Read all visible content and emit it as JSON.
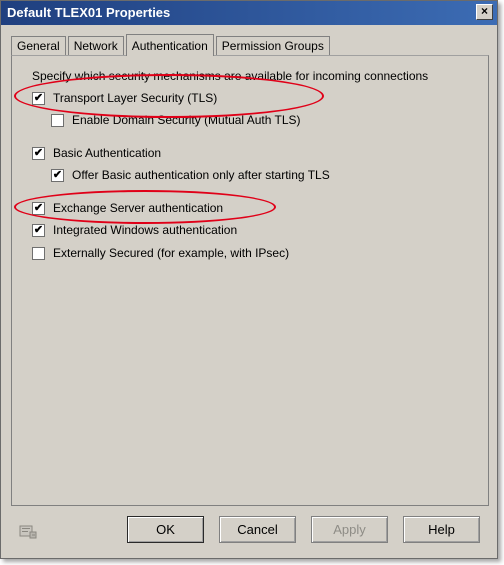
{
  "window": {
    "title": "Default TLEX01 Properties",
    "close_glyph": "×"
  },
  "tabs": [
    {
      "label": "General",
      "active": false
    },
    {
      "label": "Network",
      "active": false
    },
    {
      "label": "Authentication",
      "active": true
    },
    {
      "label": "Permission Groups",
      "active": false
    }
  ],
  "panel": {
    "description": "Specify which security mechanisms are available for incoming connections",
    "options": [
      {
        "label": "Transport Layer Security (TLS)",
        "checked": true,
        "indent": 0
      },
      {
        "label": "Enable Domain Security (Mutual Auth TLS)",
        "checked": false,
        "indent": 1
      },
      {
        "label": "Basic Authentication",
        "checked": true,
        "indent": 0
      },
      {
        "label": "Offer Basic authentication only after starting TLS",
        "checked": true,
        "indent": 1
      },
      {
        "label": "Exchange Server authentication",
        "checked": true,
        "indent": 0
      },
      {
        "label": "Integrated Windows authentication",
        "checked": true,
        "indent": 0
      },
      {
        "label": "Externally Secured (for example, with IPsec)",
        "checked": false,
        "indent": 0
      }
    ]
  },
  "annotations": {
    "color": "#e00018",
    "highlighted": [
      "Transport Layer Security (TLS)",
      "Exchange Server authentication"
    ]
  },
  "buttons": {
    "ok": "OK",
    "cancel": "Cancel",
    "apply": "Apply",
    "help": "Help"
  },
  "icons": {
    "status": "properties-page-icon",
    "check": "✔"
  }
}
